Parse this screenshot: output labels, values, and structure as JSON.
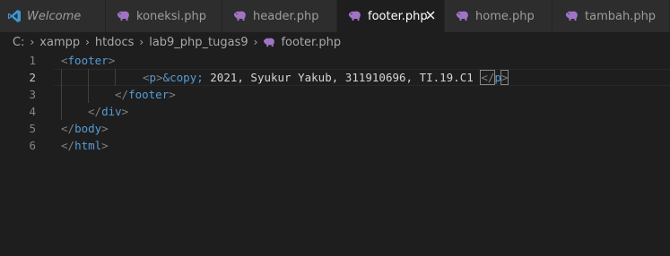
{
  "tabs": [
    {
      "label": "Welcome",
      "icon": "vscode-logo-icon",
      "italic": true,
      "active": false
    },
    {
      "label": "koneksi.php",
      "icon": "php-elephant-icon",
      "italic": false,
      "active": false
    },
    {
      "label": "header.php",
      "icon": "php-elephant-icon",
      "italic": false,
      "active": false
    },
    {
      "label": "footer.php",
      "icon": "php-elephant-icon",
      "italic": false,
      "active": true
    },
    {
      "label": "home.php",
      "icon": "php-elephant-icon",
      "italic": false,
      "active": false
    },
    {
      "label": "tambah.php",
      "icon": "php-elephant-icon",
      "italic": false,
      "active": false
    }
  ],
  "breadcrumb": {
    "parts": [
      "C:",
      "xampp",
      "htdocs",
      "lab9_php_tugas9"
    ],
    "file": "footer.php",
    "separator": "›"
  },
  "editor": {
    "current_line": 2,
    "lines": [
      {
        "num": "1",
        "code": "<footer>"
      },
      {
        "num": "2",
        "code": "<p>&copy; 2021, Syukur Yakub, 311910696, TI.19.C1 </p>"
      },
      {
        "num": "3",
        "code": "</footer>"
      },
      {
        "num": "4",
        "code": "</div>"
      },
      {
        "num": "5",
        "code": "</body>"
      },
      {
        "num": "6",
        "code": "</html>"
      }
    ],
    "tokens": {
      "l1_open": "<",
      "l1_tag": "footer",
      "l1_close": ">",
      "l2_open": "<",
      "l2_tag": "p",
      "l2_close": ">",
      "l2_entity": "&copy;",
      "l2_text": " 2021, Syukur Yakub, 311910696, TI.19.C1 ",
      "l2_end_open": "</",
      "l2_end_tag": "p",
      "l2_end_close": ">",
      "l3_open": "</",
      "l3_tag": "footer",
      "l3_close": ">",
      "l4_open": "</",
      "l4_tag": "div",
      "l4_close": ">",
      "l5_open": "</",
      "l5_tag": "body",
      "l5_close": ">",
      "l6_open": "</",
      "l6_tag": "html",
      "l6_close": ">"
    }
  },
  "colors": {
    "editor_bg": "#1e1e1e",
    "tab_inactive_bg": "#2d2d2d",
    "tag_color": "#569cd6",
    "bracket_color": "#808080",
    "text_color": "#d4d4d4",
    "php_icon_color": "#a074c4",
    "vscode_blue": "#3c99d4"
  }
}
